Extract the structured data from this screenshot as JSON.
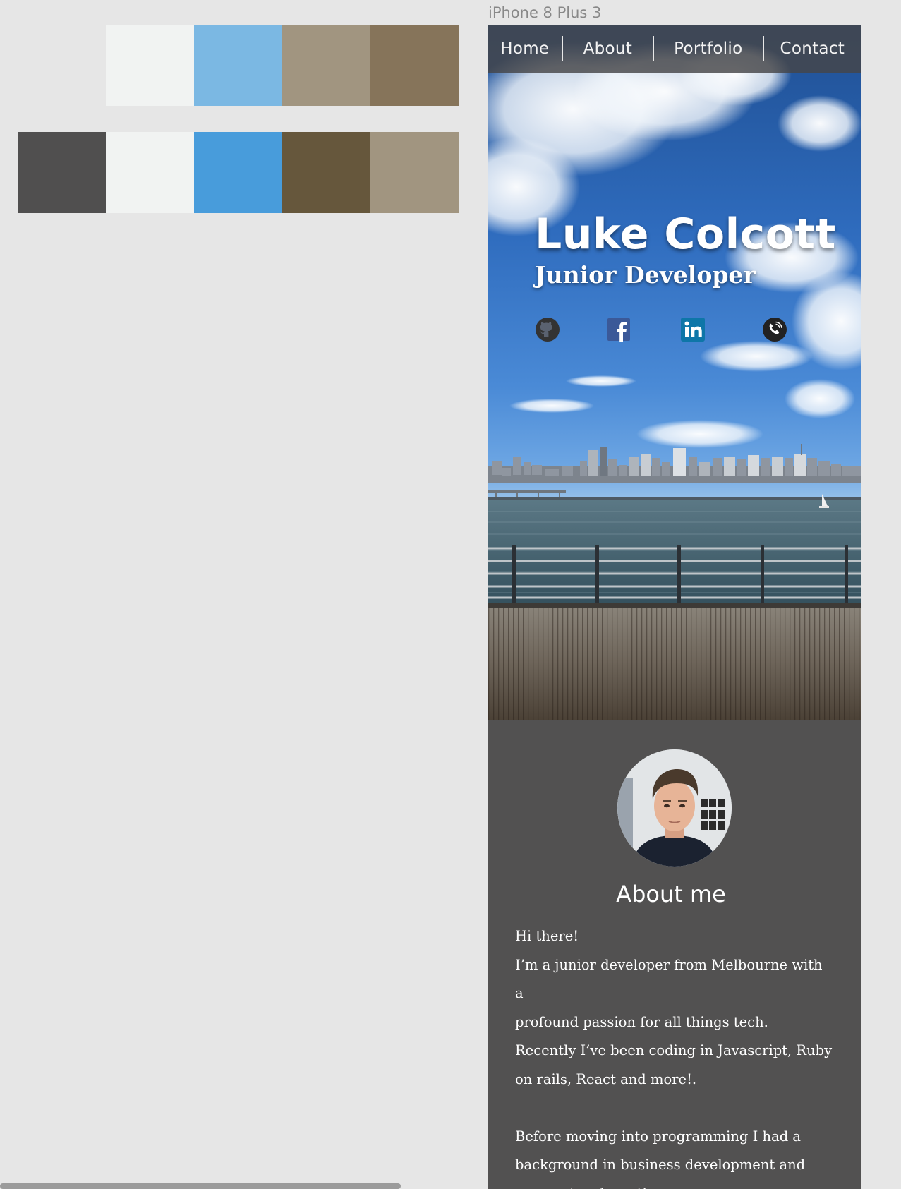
{
  "palettes": {
    "row1": [
      "#f1f3f2",
      "#7bb8e3",
      "#a19580",
      "#86745a"
    ],
    "row2": [
      "#504f4f",
      "#f1f3f2",
      "#489cdb",
      "#66573c",
      "#a19580"
    ]
  },
  "artboard": {
    "label": "iPhone 8 Plus 3"
  },
  "nav": {
    "items": [
      {
        "label": "Home"
      },
      {
        "label": "About"
      },
      {
        "label": "Portfolio"
      },
      {
        "label": "Contact"
      }
    ]
  },
  "hero": {
    "name": "Luke Colcott",
    "role": "Junior Developer",
    "social": [
      {
        "icon": "github-icon",
        "color": "#333333"
      },
      {
        "icon": "facebook-icon",
        "color": "#3b5998"
      },
      {
        "icon": "linkedin-icon",
        "color": "#0e76a8"
      },
      {
        "icon": "phone-icon",
        "color": "#222222"
      }
    ]
  },
  "about": {
    "title": "About me",
    "paragraph1": [
      "Hi there!",
      "I’m a junior developer from Melbourne with a",
      "profound passion for all things tech.",
      "Recently I’ve been coding in Javascript, Ruby",
      "on rails, React and more!."
    ],
    "paragraph2": [
      "Before moving into programming I had a",
      "background in business development and",
      "corporate edcucation."
    ]
  }
}
